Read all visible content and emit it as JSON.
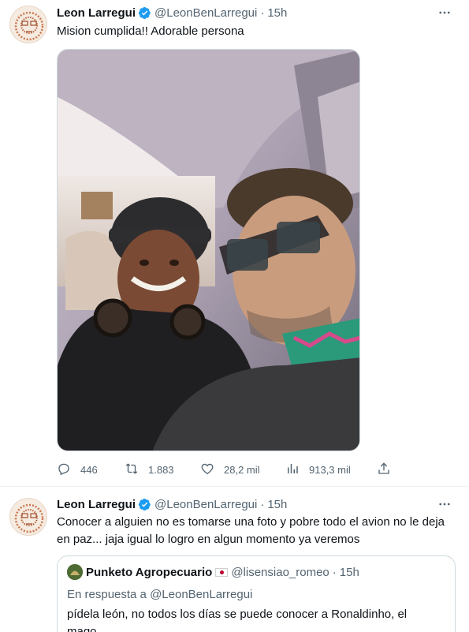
{
  "tweets": [
    {
      "author_name": "Leon Larregui",
      "handle": "@LeonBenLarregui",
      "separator": "·",
      "time": "15h",
      "text": "Mision cumplida!! Adorable persona",
      "stats": {
        "replies": "446",
        "retweets": "1.883",
        "likes": "28,2 mil",
        "views": "913,3 mil"
      }
    },
    {
      "author_name": "Leon Larregui",
      "handle": "@LeonBenLarregui",
      "separator": "·",
      "time": "15h",
      "text": "Conocer a alguien no es tomarse una foto y pobre todo el avion no le deja en paz... jaja igual lo logro en algun momento ya veremos",
      "quoted": {
        "author_name": "Punketo Agropecuario",
        "handle": "@lisensiao_romeo",
        "separator": "·",
        "time": "15h",
        "reply_context": "En respuesta a @LeonBenLarregui",
        "text": "pídela león, no todos los días se puede conocer a Ronaldinho, el mago"
      }
    }
  ],
  "colors": {
    "primary_text": "#0f1419",
    "secondary_text": "#536471",
    "verified_blue": "#1d9bf0",
    "border": "#cfd9de"
  },
  "icons": [
    "verified-badge-icon",
    "more-icon",
    "reply-icon",
    "retweet-icon",
    "like-icon",
    "views-icon",
    "share-icon"
  ]
}
